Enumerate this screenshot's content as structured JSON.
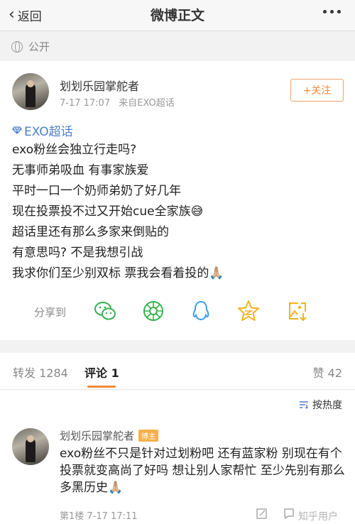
{
  "nav": {
    "back_label": "返回",
    "title": "微博正文"
  },
  "visibility": {
    "icon": "globe-icon",
    "label": "公开"
  },
  "post": {
    "author": "划划乐园掌舵者",
    "time": "7-17 17:07",
    "source": "来自EXO超话",
    "follow_label": "+关注",
    "topic": "EXO超话",
    "lines": [
      "exo粉丝会独立行走吗?",
      "无事师弟吸血 有事家族爱",
      "平时一口一个奶师弟奶了好几年",
      "现在投票投不过又开始cue全家族😅",
      "超话里还有那么多家来倒贴的",
      "有意思吗? 不是我想引战",
      "我求你们至少别双标 票我会看着投的🙏🏼"
    ],
    "share_label": "分享到",
    "share_targets": [
      "wechat-icon",
      "moments-icon",
      "qq-icon",
      "qzone-icon",
      "save-image-icon"
    ]
  },
  "tabs": {
    "repost": "转发 1284",
    "comment": "评论 1",
    "likes": "赞 42"
  },
  "sort": {
    "label": "按热度"
  },
  "comment": {
    "author": "划划乐园掌舵者",
    "badge": "博主",
    "text": "exo粉丝不只是针对过划粉吧 还有蓝家粉 别现在有个投票就变高尚了好吗 想让别人家帮忙 至少先别有那么多黑历史🙏🏼",
    "meta": "第1楼 7-17 17:11",
    "watermark": "知乎用户"
  },
  "colors": {
    "accent": "#f08b3c",
    "link": "#4c7fcc",
    "share_green": "#37b24d",
    "share_blue": "#3a9ee8",
    "share_yellow": "#f5b31a"
  }
}
